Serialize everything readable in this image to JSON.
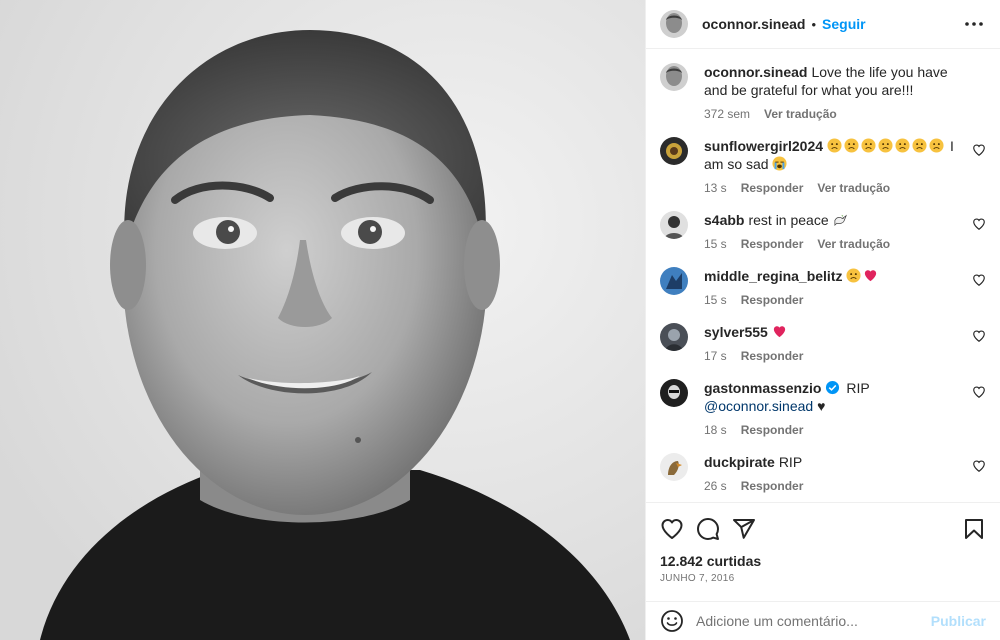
{
  "post": {
    "author": "oconnor.sinead",
    "follow_label": "Seguir",
    "separator": "•",
    "caption_user": "oconnor.sinead",
    "caption_text": "Love the life you have and be grateful for what you are!!!",
    "caption_time": "372 sem",
    "caption_translate": "Ver tradução",
    "likes": "12.842 curtidas",
    "date": "JUNHO 7, 2016"
  },
  "comments": [
    {
      "user": "sunflowergirl2024",
      "text": "I am so sad",
      "time": "13 s",
      "reply": "Responder",
      "translate": "Ver tradução"
    },
    {
      "user": "s4abb",
      "text": "rest in peace",
      "time": "15 s",
      "reply": "Responder",
      "translate": "Ver tradução"
    },
    {
      "user": "middle_regina_belitz",
      "text": "",
      "time": "15 s",
      "reply": "Responder"
    },
    {
      "user": "sylver555",
      "text": "",
      "time": "17 s",
      "reply": "Responder"
    },
    {
      "user": "gastonmassenzio",
      "text": "RIP",
      "mention": "@oconnor.sinead",
      "suffix": "♥",
      "time": "18 s",
      "reply": "Responder"
    },
    {
      "user": "duckpirate",
      "text": "RIP",
      "time": "26 s",
      "reply": "Responder"
    }
  ],
  "add_comment": {
    "placeholder": "Adicione um comentário...",
    "post_label": "Publicar"
  },
  "icons": {
    "more": "more-options-icon",
    "like": "heart-icon",
    "comment": "comment-icon",
    "share": "share-icon",
    "save": "bookmark-icon",
    "emoji": "emoji-icon"
  },
  "colors": {
    "link": "#0095f6",
    "post_disabled": "#b2dffc",
    "muted": "#737373",
    "verified": "#0095f6",
    "red_heart": "#e0245e"
  }
}
